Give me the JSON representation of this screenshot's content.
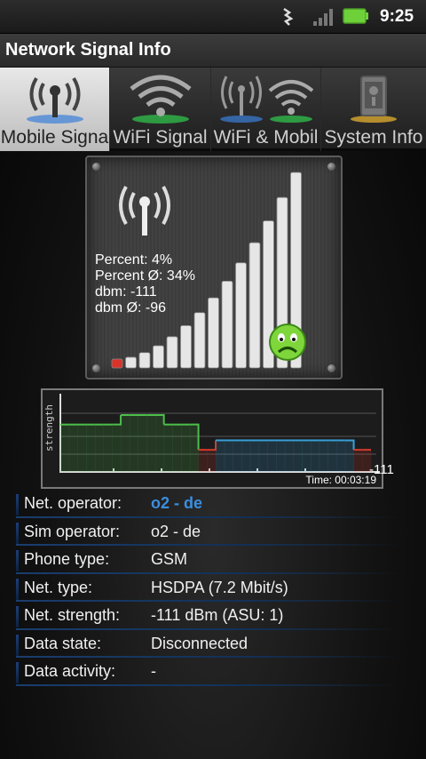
{
  "status_bar": {
    "time": "9:25",
    "icons": [
      "data-transfer-icon",
      "cell-signal-icon",
      "battery-icon"
    ],
    "battery_color": "#6fd13a"
  },
  "app": {
    "title": "Network Signal Info"
  },
  "tabs": [
    {
      "label": "Mobile Signa",
      "icon": "cell-tower-icon",
      "active": true
    },
    {
      "label": "WiFi Signal",
      "icon": "wifi-icon",
      "active": false
    },
    {
      "label": "WiFi & Mobil",
      "icon": "tower-and-wifi-icon",
      "active": false
    },
    {
      "label": "System Info",
      "icon": "phone-info-icon",
      "active": false
    }
  ],
  "signal_panel": {
    "icon": "cell-tower-icon",
    "status_icon": "sad-face-icon",
    "level": 0.04,
    "bar_count": 14,
    "stats": {
      "percent": "Percent: 4%",
      "percent_avg": "Percent Ø: 34%",
      "dbm": "dbm: -111",
      "dbm_avg": "dbm Ø: -96"
    }
  },
  "history_chart": {
    "ylabel": "strength",
    "time_label": "Time: 00:03:19",
    "current_value": "-111",
    "colors": {
      "green": "#4cbf4a",
      "blue": "#3aa0d8",
      "red": "#d23a2a"
    }
  },
  "chart_data": {
    "type": "line",
    "title": "",
    "xlabel": "",
    "ylabel": "strength",
    "series": [
      {
        "values": [
          3.0,
          3.0,
          3.0,
          3.0,
          3.0,
          3.0,
          3.0,
          3.6,
          3.6,
          3.6,
          3.6,
          3.6,
          3.0,
          3.0,
          3.0,
          3.0,
          1.4,
          1.4,
          2.0,
          2.0,
          2.0,
          2.0,
          2.0,
          2.0,
          2.0,
          2.0,
          2.0,
          2.0,
          2.0,
          2.0,
          2.0,
          2.0,
          2.0,
          2.0,
          1.4,
          1.4,
          1.4
        ]
      }
    ]
  },
  "info": [
    {
      "key": "Net. operator:",
      "value": "o2 - de",
      "highlight": true
    },
    {
      "key": "Sim operator:",
      "value": "o2 - de",
      "highlight": false
    },
    {
      "key": "Phone type:",
      "value": "GSM",
      "highlight": false
    },
    {
      "key": "Net. type:",
      "value": "HSDPA (7.2 Mbit/s)",
      "highlight": false
    },
    {
      "key": "Net. strength:",
      "value": "-111 dBm (ASU: 1)",
      "highlight": false
    },
    {
      "key": "Data state:",
      "value": "Disconnected",
      "highlight": false
    },
    {
      "key": "Data activity:",
      "value": "-",
      "highlight": false
    }
  ]
}
